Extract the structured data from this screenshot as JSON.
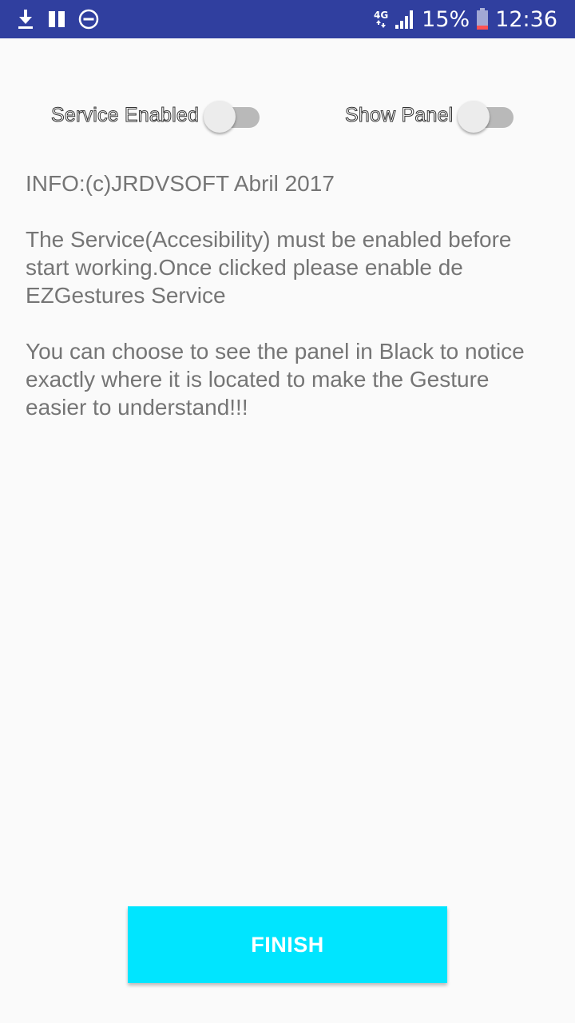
{
  "status_bar": {
    "background": "#303f9f",
    "left_icons": [
      "download-icon",
      "pause-icon",
      "do-not-disturb-icon"
    ],
    "network_type": "4G",
    "battery_percent": "15%",
    "time": "12:36"
  },
  "switches": {
    "service_enabled": {
      "label": "Service Enabled",
      "checked": false
    },
    "show_panel": {
      "label": "Show Panel",
      "checked": false
    }
  },
  "info": {
    "line1": "INFO:(c)JRDVSOFT Abril 2017",
    "paragraph2": "The Service(Accesibility) must be enabled before start working.Once clicked please enable de EZGestures Service",
    "paragraph3": "You can choose to see the panel in Black to notice exactly where it is located to make the Gesture easier to understand!!!"
  },
  "finish_button": {
    "label": "FINISH",
    "color": "#00e5ff"
  }
}
